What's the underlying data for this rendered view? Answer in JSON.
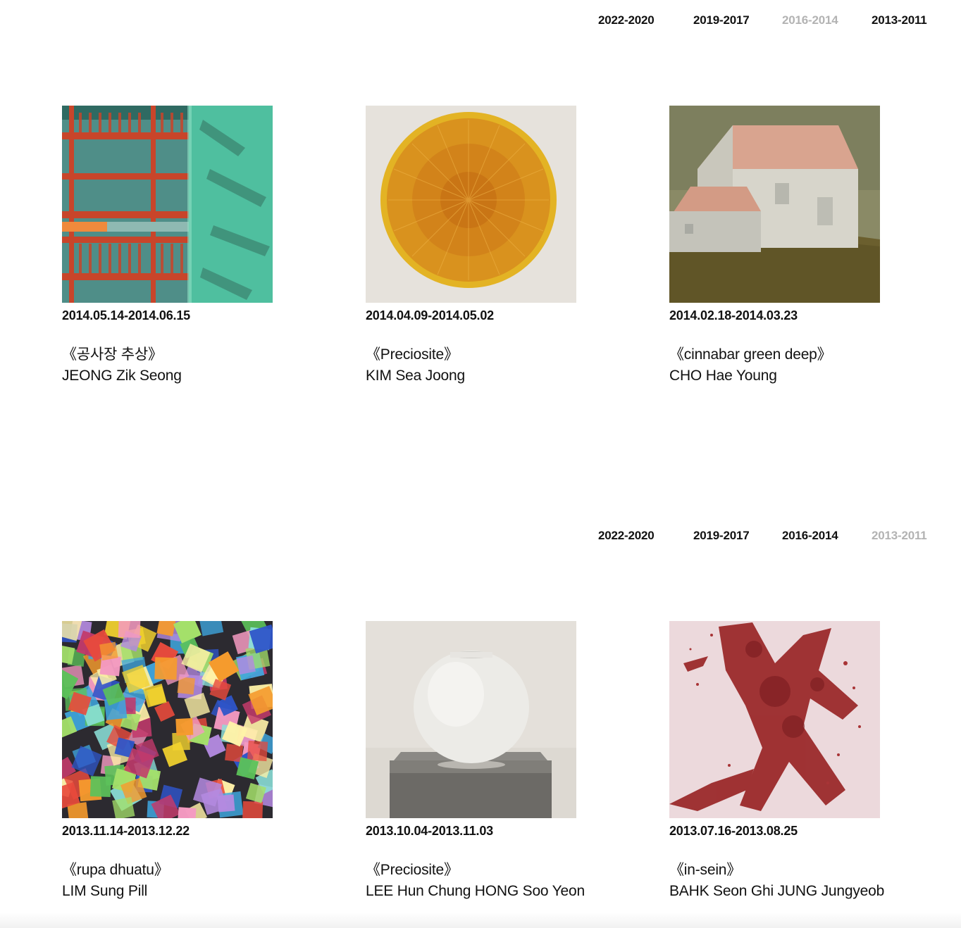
{
  "sections": [
    {
      "nav": {
        "links": [
          {
            "label": "2022-2020",
            "active": false
          },
          {
            "label": "2019-2017",
            "active": false
          },
          {
            "label": "2016-2014",
            "active": true
          },
          {
            "label": "2013-2011",
            "active": false
          }
        ]
      },
      "exhibitions": [
        {
          "date": "2014.05.14-2014.06.15",
          "title": "《공사장 추상》",
          "artist": "JEONG Zik Seong",
          "image": "abstract-construction-painting"
        },
        {
          "date": "2014.04.09-2014.05.02",
          "title": "《Preciosite》",
          "artist": "KIM Sea Joong",
          "image": "orange-circular-relief"
        },
        {
          "date": "2014.02.18-2014.03.23",
          "title": "《cinnabar green deep》",
          "artist": "CHO Hae Young",
          "image": "white-house-painting"
        }
      ]
    },
    {
      "nav": {
        "links": [
          {
            "label": "2022-2020",
            "active": false
          },
          {
            "label": "2019-2017",
            "active": false
          },
          {
            "label": "2016-2014",
            "active": false
          },
          {
            "label": "2013-2011",
            "active": true
          }
        ]
      },
      "exhibitions": [
        {
          "date": "2013.11.14-2013.12.22",
          "title": "《rupa dhuatu》",
          "artist": "LIM Sung Pill",
          "image": "colorful-squares-painting"
        },
        {
          "date": "2013.10.04-2013.11.03",
          "title": "《Preciosite》",
          "artist": "LEE Hun Chung HONG Soo Yeon",
          "image": "white-moon-jar"
        },
        {
          "date": "2013.07.16-2013.08.25",
          "title": "《in-sein》",
          "artist": "BAHK Seon Ghi JUNG Jungyeob",
          "image": "red-pigment-splash"
        }
      ]
    }
  ],
  "colors": {
    "text": "#111111",
    "inactive_nav": "#b3b3b3",
    "background": "#ffffff"
  }
}
